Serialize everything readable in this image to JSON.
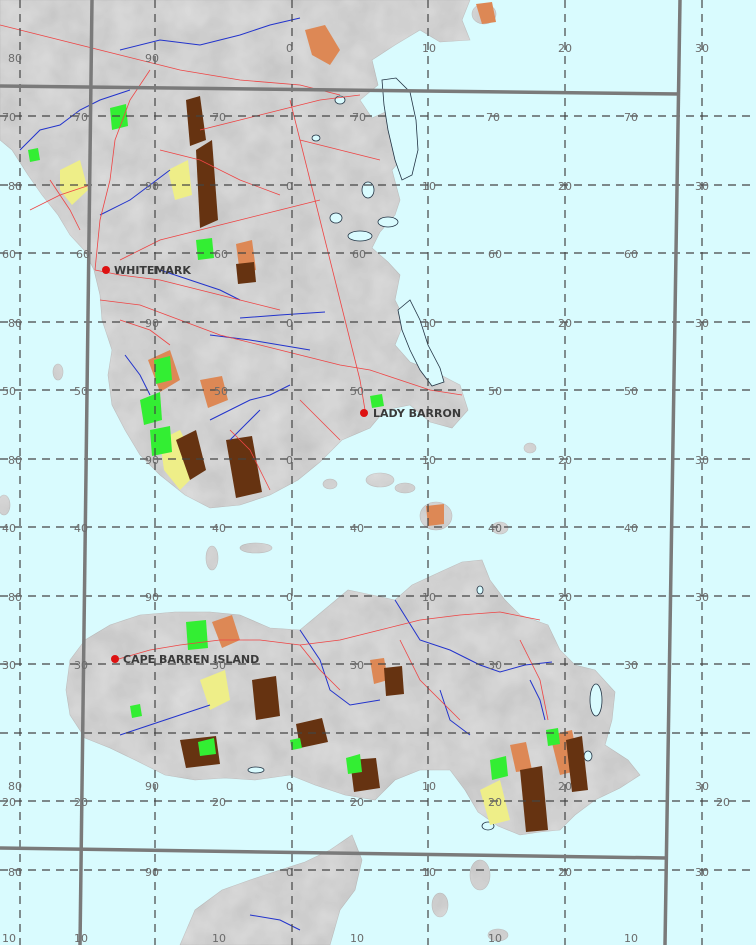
{
  "map": {
    "colors": {
      "sea": "#d9fbfe",
      "land": "#dcdcdc",
      "grid_dashed": "#444444",
      "grid_major": "#7a7a7a",
      "roads": "#ee4444",
      "rivers": "#2233cc",
      "towns": "#dd1111",
      "veg_green": "#33ee33",
      "veg_orange": "#dd8855",
      "veg_brown": "#663311",
      "veg_yellow": "#eeee88"
    },
    "towns": [
      {
        "name": "WHITEMARK"
      },
      {
        "name": "LADY BARRON"
      },
      {
        "name": "CAPE BARREN ISLAND"
      }
    ],
    "grid_labels": {
      "row_a": [
        "80",
        "90",
        "0",
        "10",
        "20",
        "30"
      ],
      "row_b": [
        "70",
        "70",
        "70",
        "70",
        "70",
        "70"
      ],
      "row_c": [
        "80",
        "90",
        "0",
        "10",
        "20",
        "30"
      ],
      "row_d": [
        "60",
        "60",
        "60",
        "60",
        "60",
        "60"
      ],
      "row_e": [
        "80",
        "90",
        "0",
        "10",
        "20",
        "30"
      ],
      "row_f": [
        "50",
        "50",
        "50",
        "50",
        "50",
        "50"
      ],
      "row_g": [
        "80",
        "90",
        "0",
        "10",
        "20",
        "30"
      ],
      "row_h": [
        "40",
        "40",
        "40",
        "40",
        "40",
        "40"
      ],
      "row_i": [
        "80",
        "90",
        "0",
        "10",
        "20",
        "30"
      ],
      "row_j": [
        "30",
        "30",
        "30",
        "30",
        "30",
        "30"
      ],
      "row_k": [
        "80",
        "90",
        "0",
        "10",
        "20",
        "30"
      ],
      "row_l": [
        "20",
        "20",
        "20",
        "20",
        "20",
        "20"
      ],
      "row_m": [
        "80",
        "90",
        "0",
        "10",
        "20",
        "30"
      ],
      "row_n": [
        "10",
        "10",
        "10",
        "10",
        "10",
        "10"
      ]
    }
  }
}
